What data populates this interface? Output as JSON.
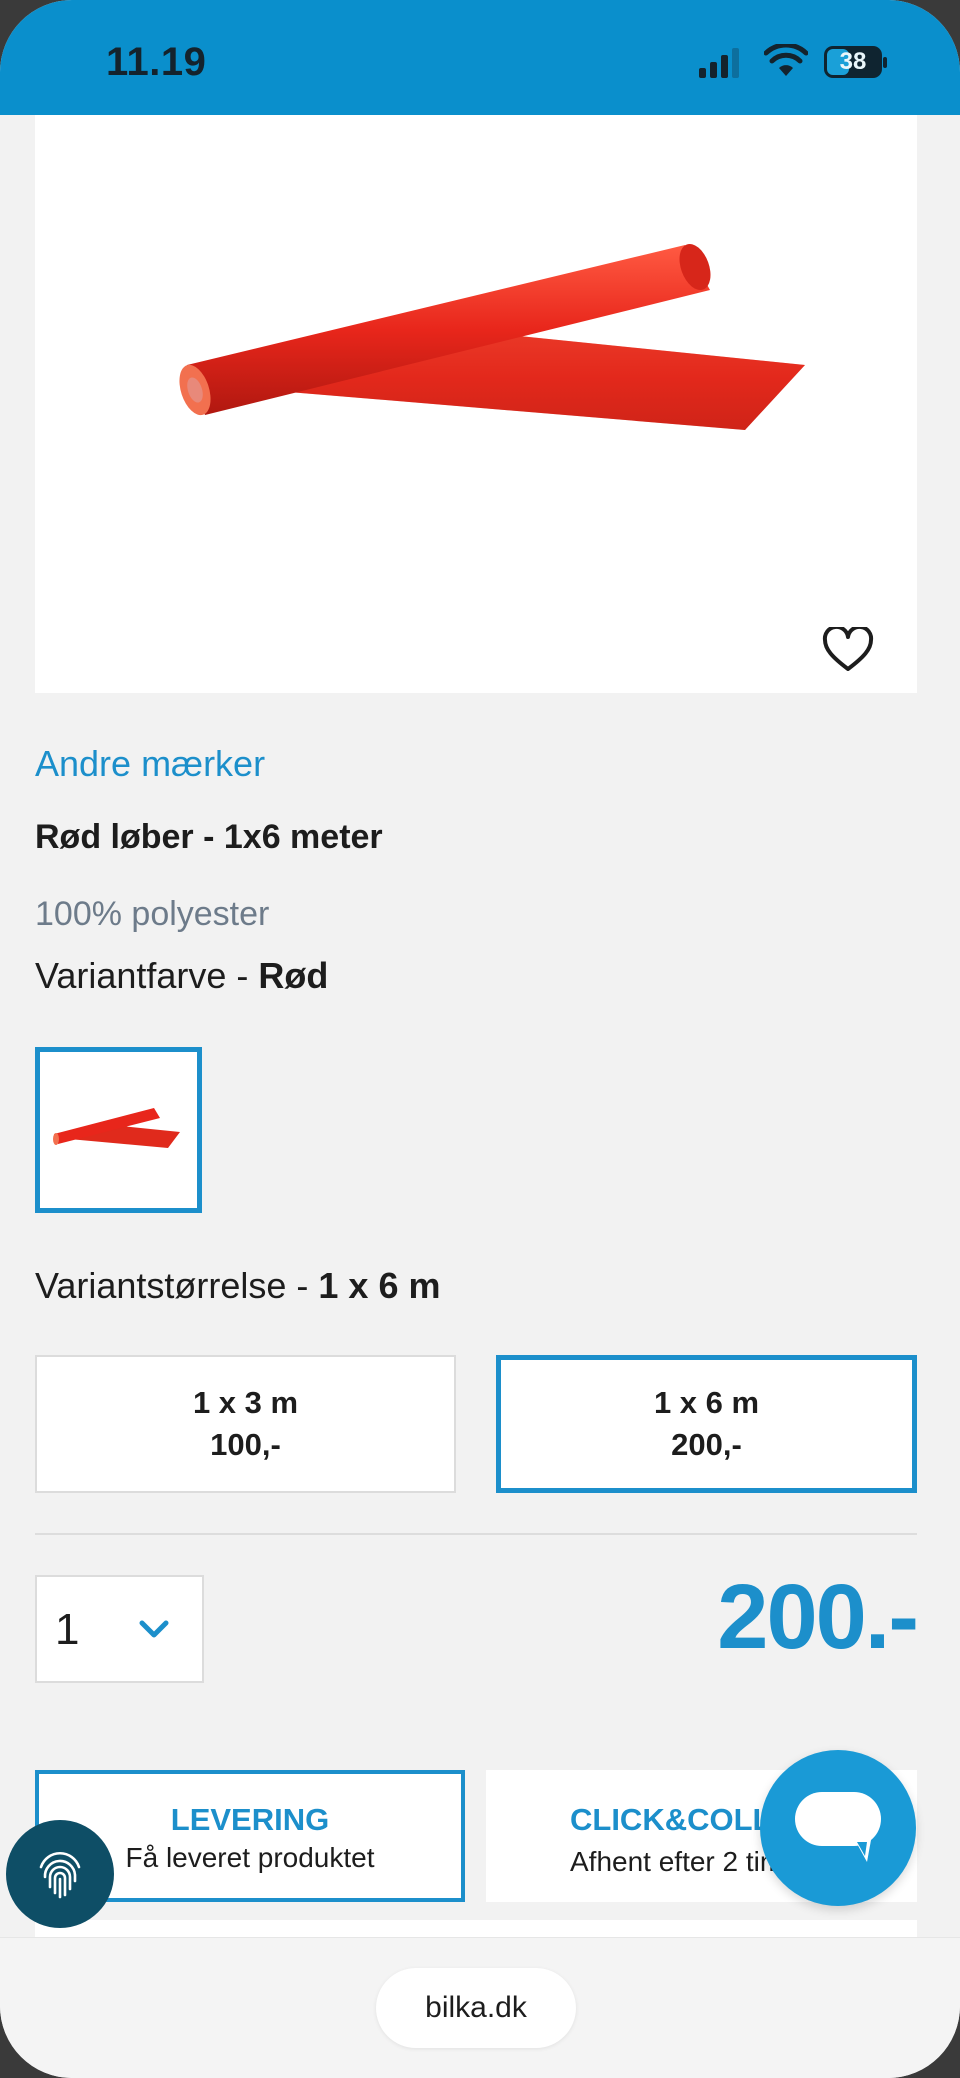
{
  "status_bar": {
    "time": "11.19",
    "battery": "38",
    "icons": [
      "signal-icon",
      "wifi-icon",
      "battery-icon"
    ]
  },
  "product": {
    "brand": "Andre mærker",
    "title": "Rød løber - 1x6 meter",
    "material": "100% polyester",
    "variant_color_label": "Variantfarve - ",
    "variant_color_value": "Rød",
    "variant_size_label": "Variantstørrelse - ",
    "variant_size_value": "1 x 6 m",
    "image_color": "#e8261b"
  },
  "size_options": [
    {
      "size": "1 x 3 m",
      "price": "100,-",
      "selected": false
    },
    {
      "size": "1 x 6 m",
      "price": "200,-",
      "selected": true
    }
  ],
  "quantity": {
    "value": "1"
  },
  "price": "200.-",
  "fulfillment": {
    "delivery_title": "LEVERING",
    "delivery_sub": "Få leveret produktet",
    "click_title": "CLICK&COLLECT",
    "click_sub": "Afhent efter 2 timer"
  },
  "browser": {
    "url": "bilka.dk"
  },
  "colors": {
    "accent": "#1c8fcb",
    "status_bar": "#0a8fcc",
    "chat": "#1a9ad6"
  }
}
